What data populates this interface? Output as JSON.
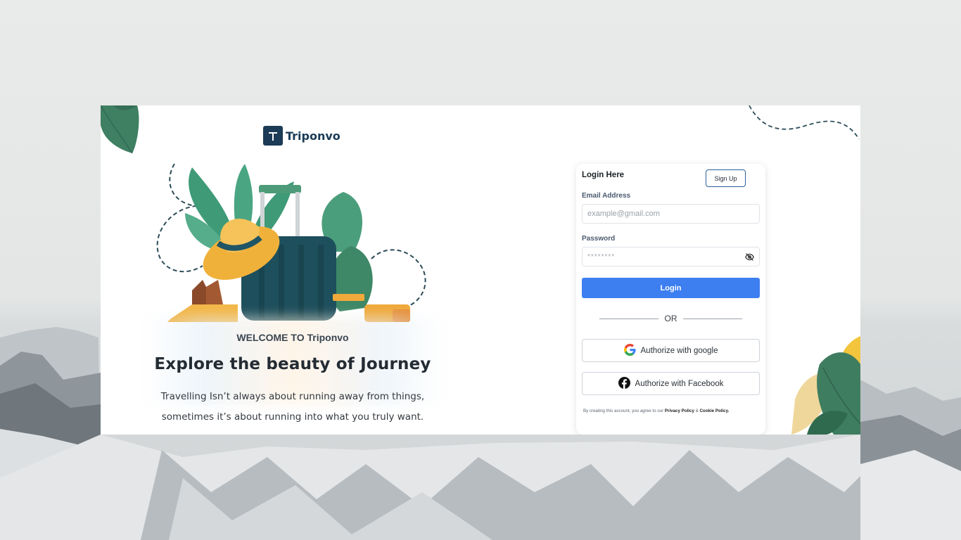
{
  "brand": {
    "name": "Triponvo"
  },
  "hero": {
    "welcome": "WELCOME TO Triponvo",
    "headline": "Explore the beauty of Journey",
    "tagline_line1": "Travelling Isn’t always about running away from things,",
    "tagline_line2": "sometimes it’s about running into what you truly want."
  },
  "login": {
    "title": "Login Here",
    "signup_label": "Sign Up",
    "email_label": "Email Address",
    "email_placeholder": "example@gmail.com",
    "password_label": "Password",
    "password_placeholder": "********",
    "login_label": "Login",
    "or_text": "OR",
    "google_label": "Authorize with google",
    "facebook_label": "Authorize with Facebook",
    "terms_prefix": "By creating this account, you agree to our ",
    "privacy_link": "Privacy Policy",
    "terms_and": " & ",
    "cookie_link": "Cookie Policy."
  },
  "colors": {
    "brand": "#1b3b57",
    "primary_button": "#3d7ef1",
    "leaf_green": "#3f8a6a",
    "leaf_yellow": "#f2c53d"
  },
  "icons": {
    "logo": "logo-icon",
    "password_toggle": "eye-off-icon",
    "google": "google-icon",
    "facebook": "facebook-icon"
  }
}
